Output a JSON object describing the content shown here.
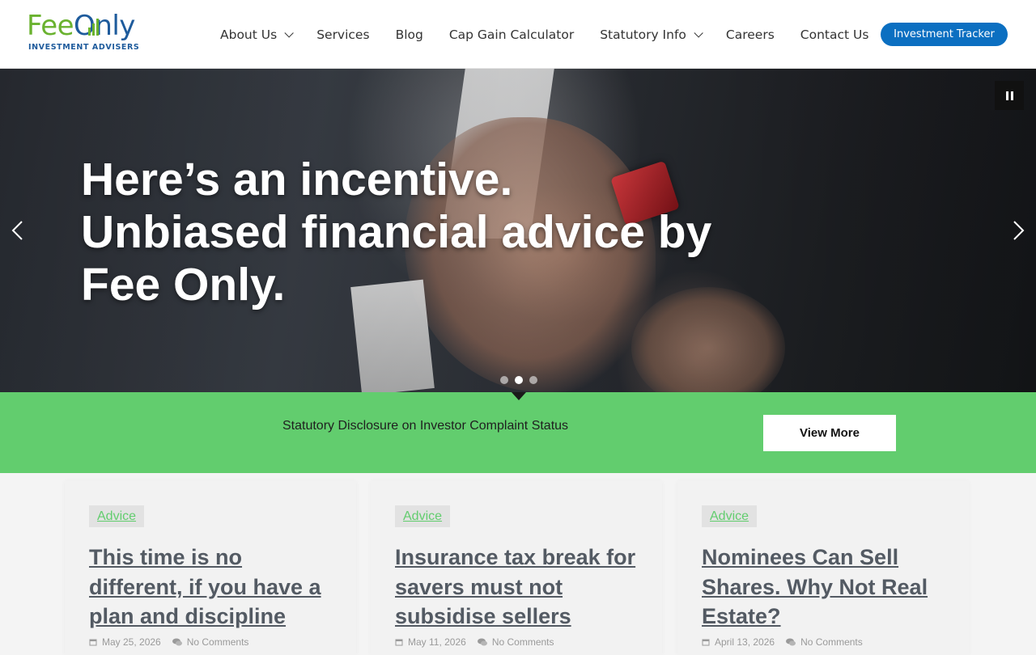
{
  "header": {
    "logo": {
      "fee": "Fee",
      "o": "O",
      "only": "nly",
      "subtitle": "INVESTMENT ADVISERS"
    },
    "nav": [
      {
        "label": "About Us",
        "has_dropdown": true
      },
      {
        "label": "Services",
        "has_dropdown": false
      },
      {
        "label": "Blog",
        "has_dropdown": false
      },
      {
        "label": "Cap Gain Calculator",
        "has_dropdown": false
      },
      {
        "label": "Statutory Info",
        "has_dropdown": true
      },
      {
        "label": "Careers",
        "has_dropdown": false
      },
      {
        "label": "Contact Us",
        "has_dropdown": false
      }
    ],
    "cta_label": "Investment Tracker"
  },
  "hero": {
    "headline_lines": [
      "Here’s an incentive.",
      "Unbiased financial advice by",
      "Fee Only."
    ],
    "slides_total": 3,
    "active_slide": 2,
    "controls": {
      "pause_icon": "pause-icon",
      "prev_icon": "chevron-left-icon",
      "next_icon": "chevron-right-icon"
    }
  },
  "band": {
    "text": "Statutory Disclosure on Investor Complaint Status",
    "button_label": "View More"
  },
  "posts": [
    {
      "category": "Advice",
      "title": "This time is no different, if you have a plan and discipline",
      "date": "May 25, 2026",
      "comments": "No Comments"
    },
    {
      "category": "Advice",
      "title": "Insurance tax break for savers must not subsidise sellers",
      "date": "May 11, 2026",
      "comments": "No Comments"
    },
    {
      "category": "Advice",
      "title": "Nominees Can Sell Shares. Why Not Real Estate?",
      "date": "April 13, 2026",
      "comments": "No Comments"
    }
  ],
  "colors": {
    "brand_green": "#6ab22f",
    "brand_blue": "#1e5b9c",
    "cta_blue": "#0b6fc1",
    "band_green": "#62cd6e",
    "title_gray": "#535a63"
  }
}
